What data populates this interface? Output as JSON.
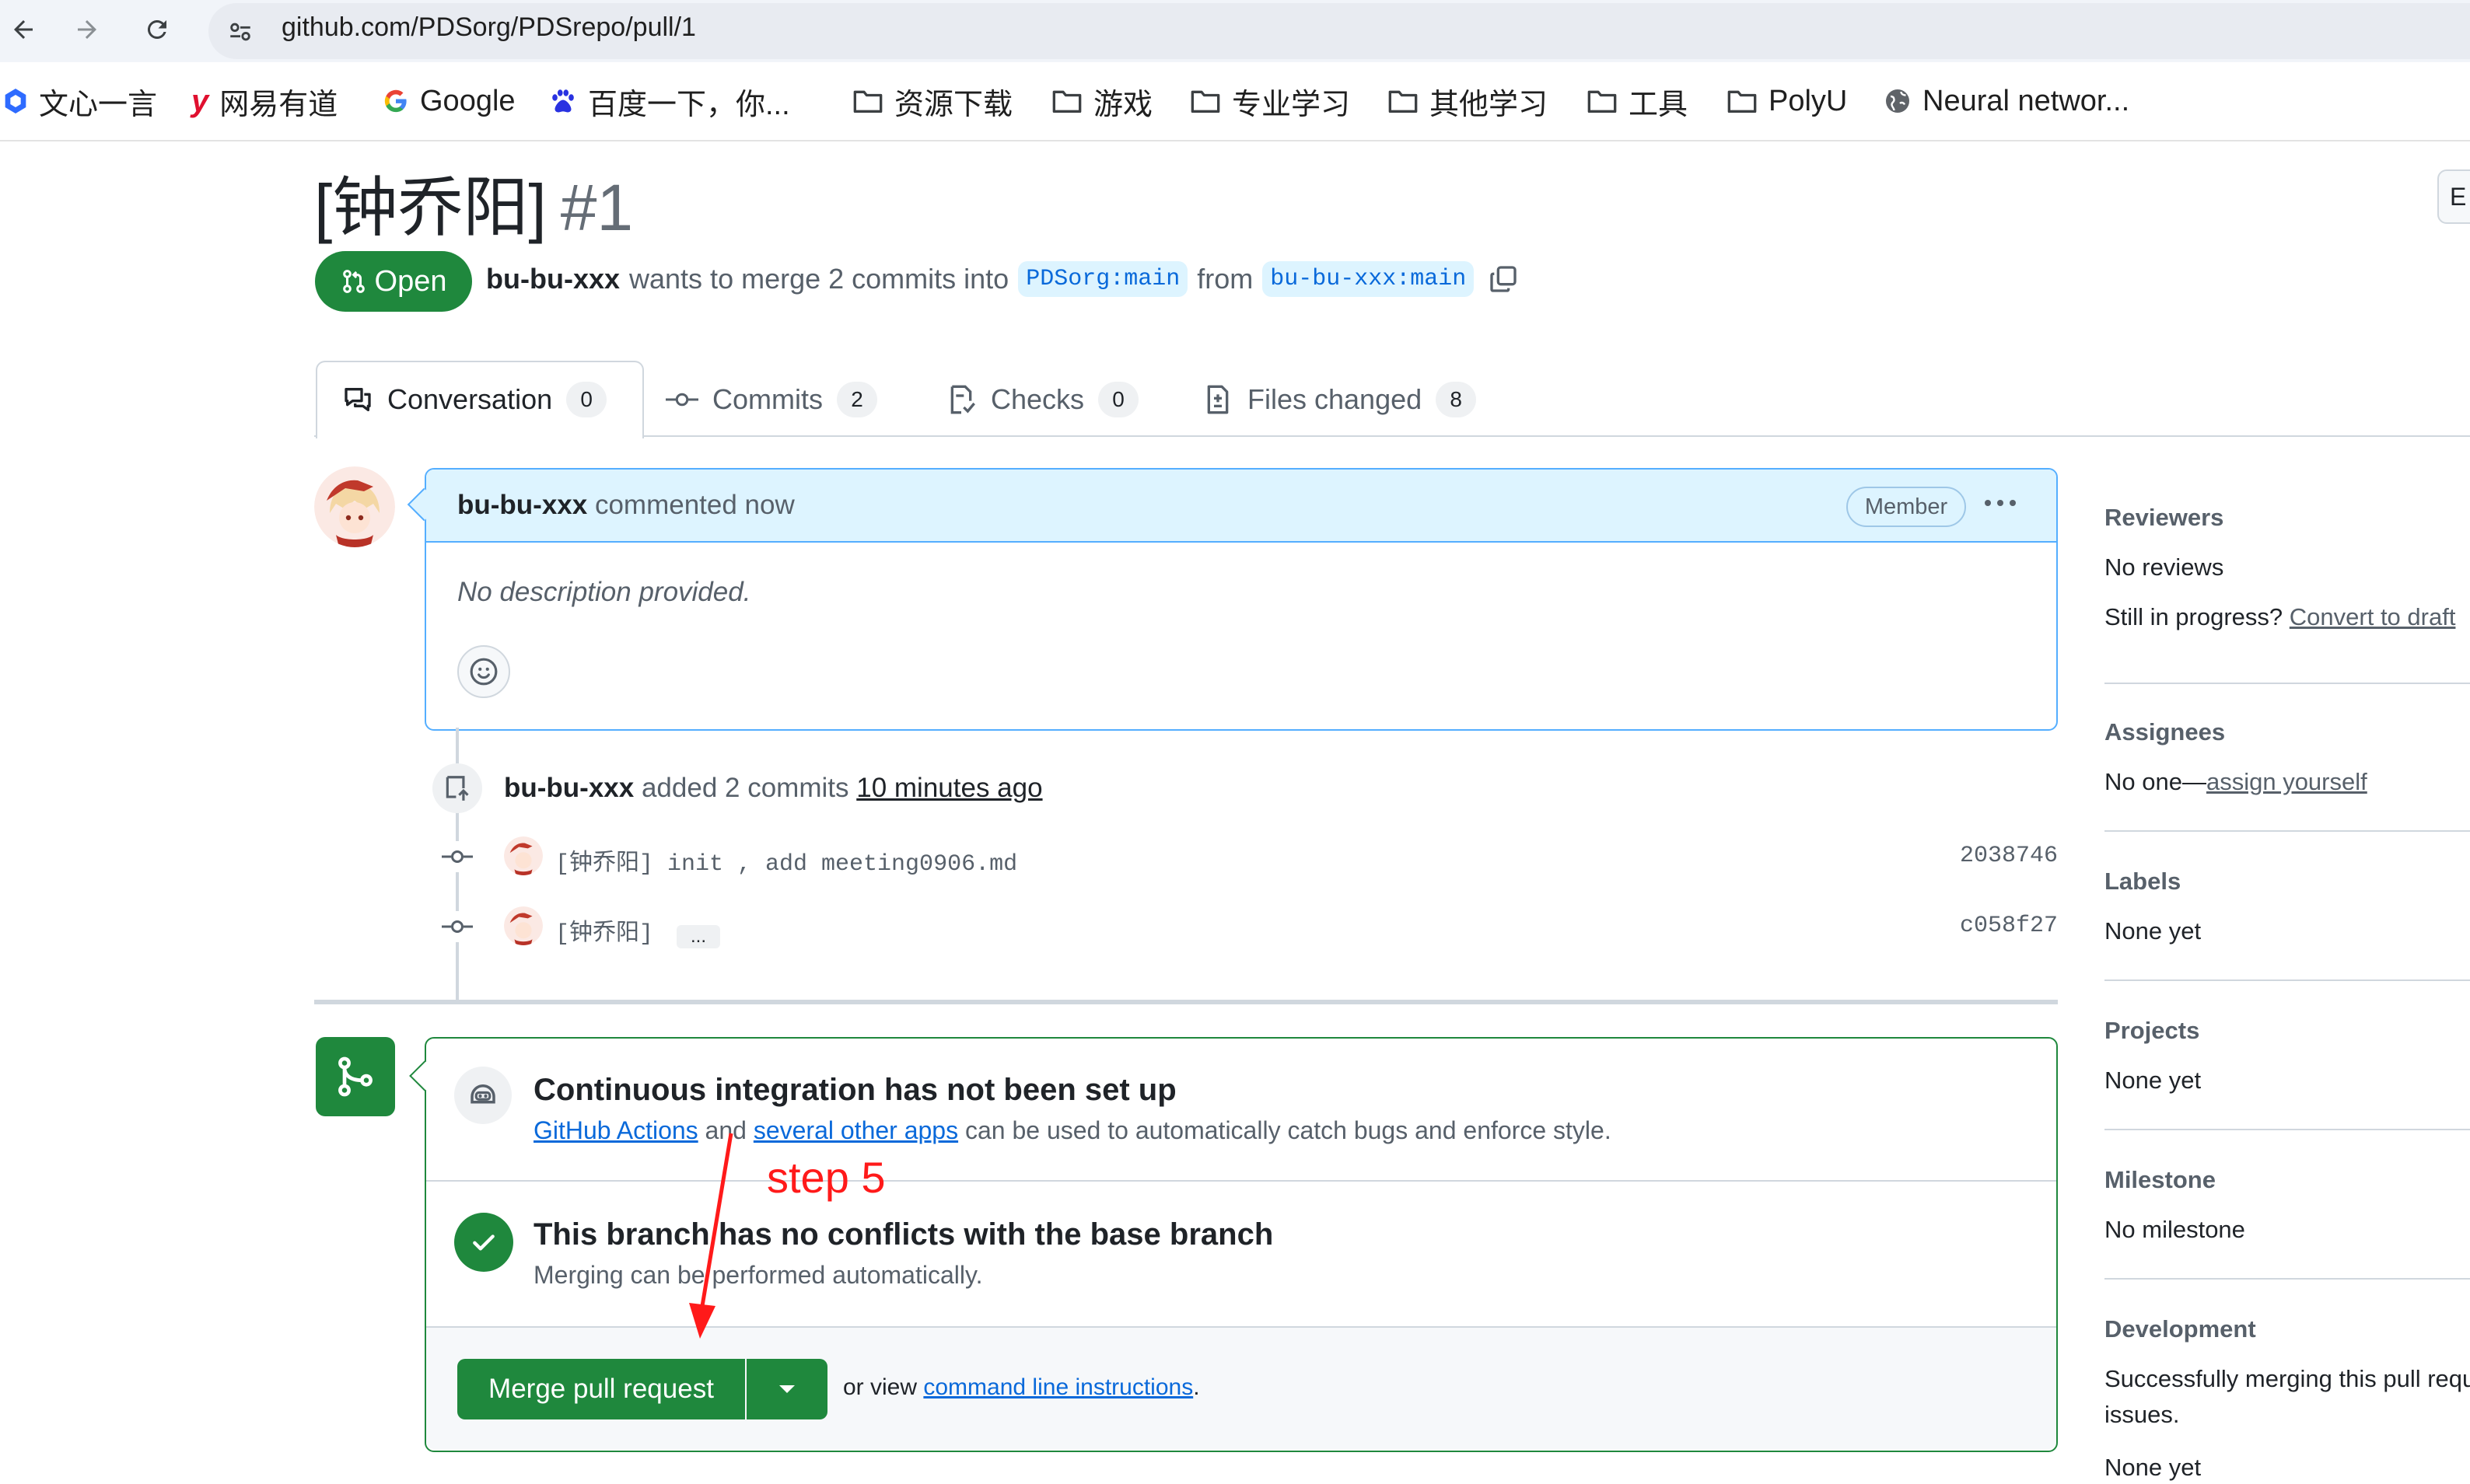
{
  "browser": {
    "url": "github.com/PDSorg/PDSrepo/pull/1",
    "icons": [
      "back-arrow-icon",
      "forward-arrow-icon",
      "reload-icon",
      "site-settings-icon"
    ],
    "bookmarks": [
      {
        "label": "文心一言",
        "icon": "wenxin-icon"
      },
      {
        "label": "网易有道",
        "icon": "youdao-icon"
      },
      {
        "label": "Google",
        "icon": "google-icon"
      },
      {
        "label": "百度一下，你...",
        "icon": "baidu-icon"
      },
      {
        "label": "资源下载",
        "icon": "folder-icon"
      },
      {
        "label": "游戏",
        "icon": "folder-icon"
      },
      {
        "label": "专业学习",
        "icon": "folder-icon"
      },
      {
        "label": "其他学习",
        "icon": "folder-icon"
      },
      {
        "label": "工具",
        "icon": "folder-icon"
      },
      {
        "label": "PolyU",
        "icon": "folder-icon"
      },
      {
        "label": "Neural networ...",
        "icon": "globe-icon"
      }
    ]
  },
  "pr": {
    "title": "[钟乔阳]",
    "number": "#1",
    "state": "Open",
    "author": "bu-bu-xxx",
    "meta_text": "wants to merge 2 commits into",
    "base_branch": "PDSorg:main",
    "from_text": "from",
    "head_branch": "bu-bu-xxx:main",
    "edit_label": "E"
  },
  "tabs": [
    {
      "label": "Conversation",
      "count": "0",
      "icon": "conversation-icon"
    },
    {
      "label": "Commits",
      "count": "2",
      "icon": "commit-icon"
    },
    {
      "label": "Checks",
      "count": "0",
      "icon": "checklist-icon"
    },
    {
      "label": "Files changed",
      "count": "8",
      "icon": "file-diff-icon"
    }
  ],
  "comment": {
    "author": "bu-bu-xxx",
    "action": "commented now",
    "badge": "Member",
    "body": "No description provided."
  },
  "timeline": {
    "author": "bu-bu-xxx",
    "action": "added 2 commits",
    "time": "10 minutes ago",
    "commits": [
      {
        "message": "[钟乔阳] init , add meeting0906.md",
        "sha": "2038746"
      },
      {
        "message": "[钟乔阳]",
        "sha": "c058f27",
        "ellipsis": "..."
      }
    ]
  },
  "merge": {
    "ci_title": "Continuous integration has not been set up",
    "ci_link1": "GitHub Actions",
    "ci_and": "and",
    "ci_link2": "several other apps",
    "ci_rest": "can be used to automatically catch bugs and enforce style.",
    "ok_title": "This branch has no conflicts with the base branch",
    "ok_desc": "Merging can be performed automatically.",
    "button": "Merge pull request",
    "alt_prefix": "or view",
    "alt_link": "command line instructions",
    "alt_suffix": "."
  },
  "annotation": {
    "label": "step 5",
    "color": "#ff1a1a"
  },
  "sidebar": {
    "reviewers_title": "Reviewers",
    "reviewers_value": "No reviews",
    "draft_prefix": "Still in progress?",
    "draft_link": "Convert to draft",
    "assignees_title": "Assignees",
    "assignees_prefix": "No one—",
    "assignees_link": "assign yourself",
    "labels_title": "Labels",
    "labels_value": "None yet",
    "projects_title": "Projects",
    "projects_value": "None yet",
    "milestone_title": "Milestone",
    "milestone_value": "No milestone",
    "development_title": "Development",
    "development_line1": "Successfully merging this pull reque",
    "development_line2": "issues.",
    "development_value": "None yet"
  },
  "colors": {
    "accent_green": "#1f883d",
    "link_blue": "#0969da",
    "comment_header_bg": "#ddf4ff"
  }
}
